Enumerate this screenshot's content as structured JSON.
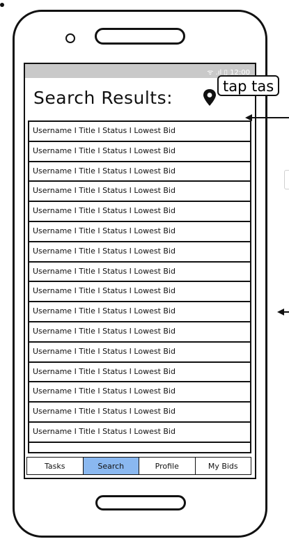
{
  "header": {
    "title": "Search Results:"
  },
  "annotation": {
    "label": "tap tas"
  },
  "status_bar": {
    "icons": "ᯤ .ıl ▯ 12:00"
  },
  "results": [
    "Username I Title I Status I Lowest Bid",
    "Username I Title I Status I Lowest Bid",
    "Username I Title I Status I Lowest Bid",
    "Username I Title I Status I Lowest Bid",
    "Username I Title I Status I Lowest Bid",
    "Username I Title I Status I Lowest Bid",
    "Username I Title I Status I Lowest Bid",
    "Username I Title I Status I Lowest Bid",
    "Username I Title I Status I Lowest Bid",
    "Username I Title I Status I Lowest Bid",
    "Username I Title I Status I Lowest Bid",
    "Username I Title I Status I Lowest Bid",
    "Username I Title I Status I Lowest Bid",
    "Username I Title I Status I Lowest Bid",
    "Username I Title I Status I Lowest Bid",
    "Username I Title I Status I Lowest Bid",
    ""
  ],
  "tabs": [
    {
      "label": "Tasks"
    },
    {
      "label": "Search"
    },
    {
      "label": "Profile"
    },
    {
      "label": "My Bids"
    }
  ],
  "active_tab": "Search",
  "colors": {
    "active_tab": "#8ab8f0",
    "status_bar": "#c9c9c9",
    "outline": "#111111"
  },
  "icons": [
    "map-pin-icon",
    "arrow-left-icon"
  ]
}
